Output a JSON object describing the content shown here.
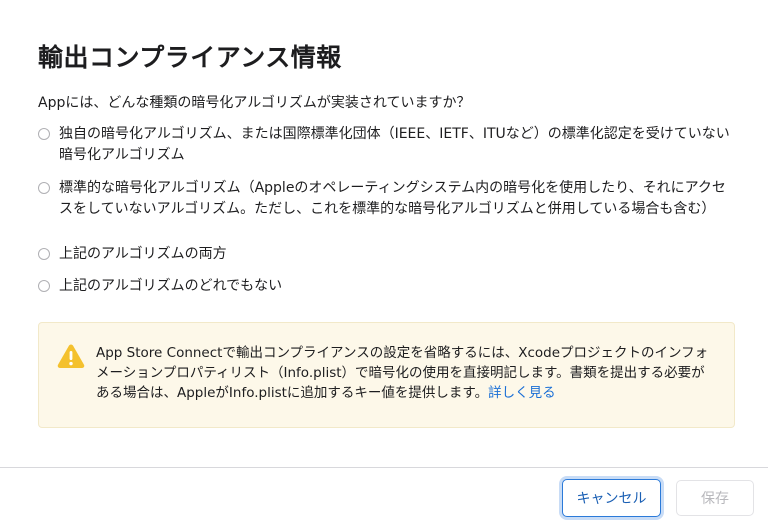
{
  "dialog": {
    "title": "輸出コンプライアンス情報",
    "question": "Appには、どんな種類の暗号化アルゴリズムが実装されていますか？",
    "options": [
      {
        "label": "独自の暗号化アルゴリズム、または国際標準化団体（IEEE、IETF、ITUなど）の標準化認定を受けていない暗号化アルゴリズム",
        "selected": false
      },
      {
        "label": "標準的な暗号化アルゴリズム（Appleのオペレーティングシステム内の暗号化を使用したり、それにアクセスをしていないアルゴリズム。ただし、これを標準的な暗号化アルゴリズムと併用している場合も含む）",
        "selected": false
      },
      {
        "label": "上記のアルゴリズムの両方",
        "selected": false
      },
      {
        "label": "上記のアルゴリズムのどれでもない",
        "selected": false
      }
    ],
    "notice": {
      "icon": "warning-icon",
      "text": "App Store Connectで輸出コンプライアンスの設定を省略するには、Xcodeプロジェクトのインフォメーションプロパティリスト（Info.plist）で暗号化の使用を直接明記します。書類を提出する必要がある場合は、AppleがInfo.plistに追加するキー値を提供します。",
      "link_label": "詳しく見る"
    },
    "buttons": {
      "cancel_label": "キャンセル",
      "save_label": "保存"
    }
  },
  "colors": {
    "accent": "#1a6fd6",
    "notice_background": "#fdf8e9",
    "warning": "#f4c12e"
  }
}
